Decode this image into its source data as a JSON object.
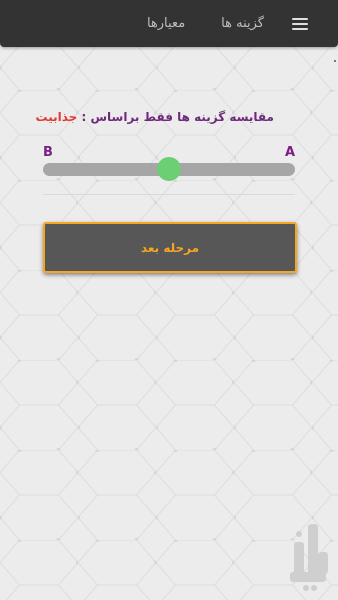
{
  "topbar": {
    "tabs": [
      {
        "label": "معیارها"
      },
      {
        "label": "گزینه ها"
      }
    ]
  },
  "comparison": {
    "prefix": "مقایسه گزینه ها فقط براساس : ",
    "criterion": "جذابیت",
    "left_label": "B",
    "right_label": "A",
    "slider_fraction": 0.5
  },
  "next_button": {
    "label": "مرحله بعد"
  },
  "colors": {
    "topbar_bg": "#333333",
    "prompt_text": "#6d2b7a",
    "criterion_text": "#e53935",
    "slider_thumb": "#6ccf73",
    "button_border": "#f5a623"
  },
  "logo": {
    "text": "بازار",
    "icon": "bazaar-watermark-logo"
  }
}
